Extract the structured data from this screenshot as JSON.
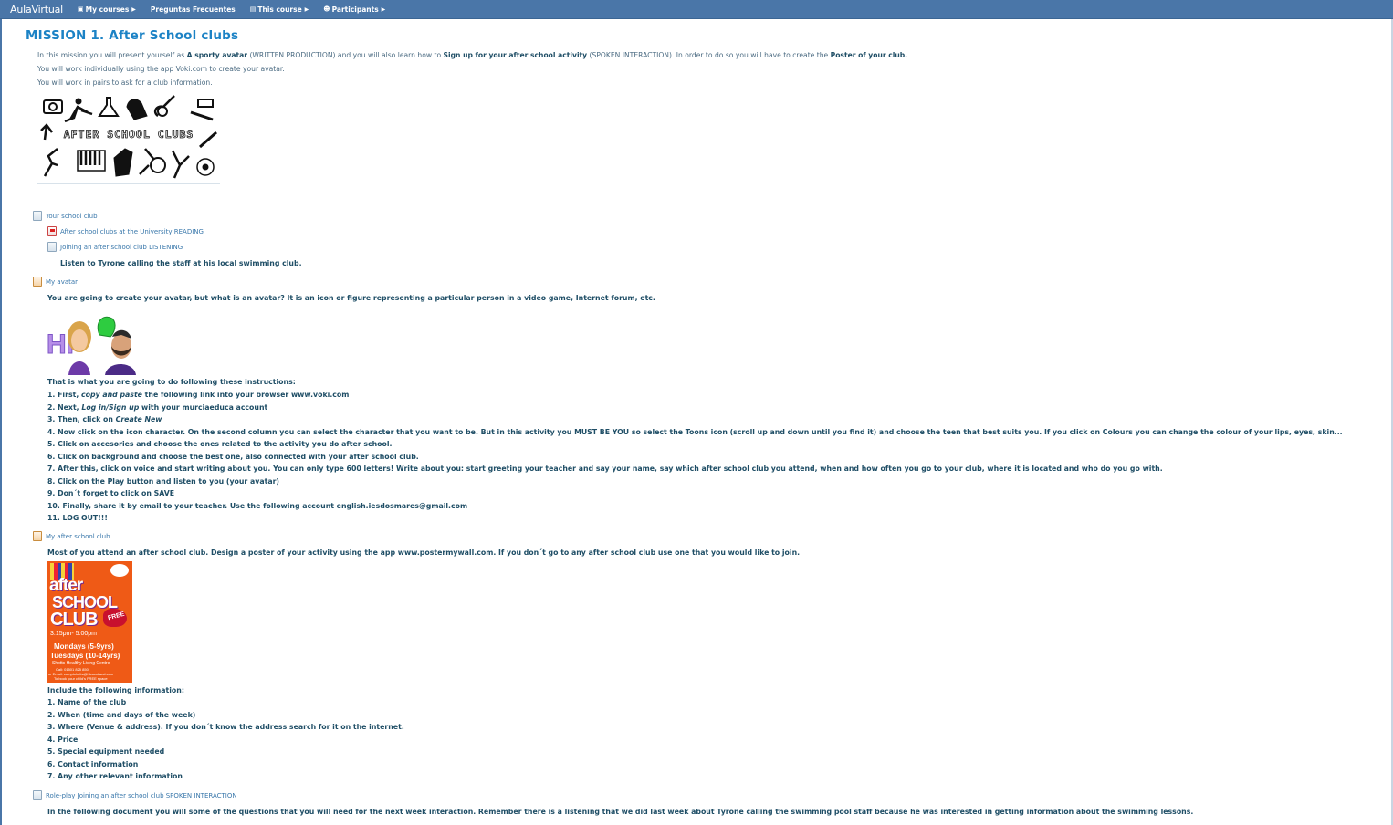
{
  "navbar": {
    "brand": "AulaVirtual",
    "items": [
      {
        "label": "My courses",
        "icon": "briefcase-icon"
      },
      {
        "label": "Preguntas Frecuentes",
        "icon": ""
      },
      {
        "label": "This course",
        "icon": "book-icon"
      },
      {
        "label": "Participants",
        "icon": "users-icon"
      }
    ]
  },
  "mission": {
    "title": "MISSION 1. After School clubs",
    "intro_line1_parts": [
      "In this mission you will present yourself as ",
      "A sporty avatar",
      " (WRITTEN PRODUCTION) and you will also learn how to ",
      "Sign up for your after school activity",
      " (SPOKEN INTERACTION). In order to do so you will have to create the ",
      "Poster of your club."
    ],
    "intro_line2": "You will work individually using the app Voki.com to create your avatar.",
    "intro_line3": "You will work in pairs to ask for a club information.",
    "banner_text": "AFTER SCHOOL CLUBS"
  },
  "section_school_club": {
    "link": "Your school club",
    "reading_link": "After school clubs at the University READING",
    "listening_link": "Joining an after school club LISTENING",
    "listening_desc": "Listen to Tyrone calling the staff at his local swimming club."
  },
  "section_avatar": {
    "link": "My avatar",
    "intro": "You are going to create your avatar, but what is an avatar? It is an icon or figure representing a particular person in a video game, Internet forum, etc.",
    "avatar_greeting": "Hi",
    "instructions_heading": "That is what you are going to do following these instructions:",
    "steps": [
      {
        "pre": "1. First, ",
        "em": "copy and paste",
        "post": " the following link into your browser www.voki.com"
      },
      {
        "pre": "2. Next, ",
        "em": "Log in/Sign up",
        "post": " with your murciaeduca account"
      },
      {
        "pre": "3. Then, click on ",
        "em": "Create New",
        "post": ""
      },
      {
        "pre": "4. Now click on the icon character. On the second column you can select the character that you want to be. But in this activity you MUST BE YOU so select the Toons icon (scroll up and down until you find it) and choose the teen that best suits you.  If you click on Colours you can change the colour of your lips, eyes, skin...",
        "em": "",
        "post": ""
      },
      {
        "pre": "5. Click on accesories and choose the ones related to the activity you do after school.",
        "em": "",
        "post": ""
      },
      {
        "pre": "6. Click on background and choose the best one, also connected with your after school club.",
        "em": "",
        "post": ""
      },
      {
        "pre": "7. After this, click on voice and start writing about you. You can only type 600 letters! Write about you: start greeting your teacher and say your name, say which after school club you attend, when and how often you go to your club, where it is located and who do you go with.",
        "em": "",
        "post": ""
      },
      {
        "pre": "8. Click on the Play button and listen to you (your avatar)",
        "em": "",
        "post": ""
      },
      {
        "pre": "9. Don´t forget to click on SAVE",
        "em": "",
        "post": ""
      },
      {
        "pre": "10. Finally, share it by email to your teacher. Use the following account english.iesdosmares@gmail.com",
        "em": "",
        "post": ""
      },
      {
        "pre": "11. LOG OUT!!!",
        "em": "",
        "post": ""
      }
    ]
  },
  "section_poster": {
    "link": "My after school club",
    "intro": "Most of you attend an after school club. Design a poster of your activity using the app www.postermywall.com. If you don´t go to any after school club use one that you would like to join.",
    "poster": {
      "line1": "after",
      "line2": "SCHOOL",
      "line3": "CLUB",
      "free": "FREE",
      "time": "3.15pm- 5.00pm",
      "days1": "Mondays  (5-9yrs)",
      "days2": "Tuesdays (10-14yrs)",
      "venue": "Shotts Healthy Living Centre",
      "contact": "Call: 01501 825 850",
      "email": "or Email: comptshotts@hlcscotland.com",
      "footer": "To book your child's FREE space"
    },
    "include_heading": "Include the following information:",
    "items": [
      "1. Name of the club",
      "2. When (time and days of the week)",
      "3. Where (Venue & address). If you don´t know the address search for it on the internet.",
      "4. Price",
      "5. Special equipment needed",
      "6. Contact information",
      "7. Any other relevant information"
    ]
  },
  "section_roleplay": {
    "link": "Role-play Joining an after school club SPOKEN INTERACTION",
    "desc": "In the following document you will some of the questions that you will need for the next week interaction. Remember there is a listening that we did last week about Tyrone calling the swimming pool staff because he was interested in getting information about the swimming lessons."
  },
  "colors": {
    "navbar": "#4a76a8",
    "title": "#1b82c5",
    "link": "#3a78ab",
    "text": "#1f4e66",
    "poster_bg": "#ef5a16"
  }
}
